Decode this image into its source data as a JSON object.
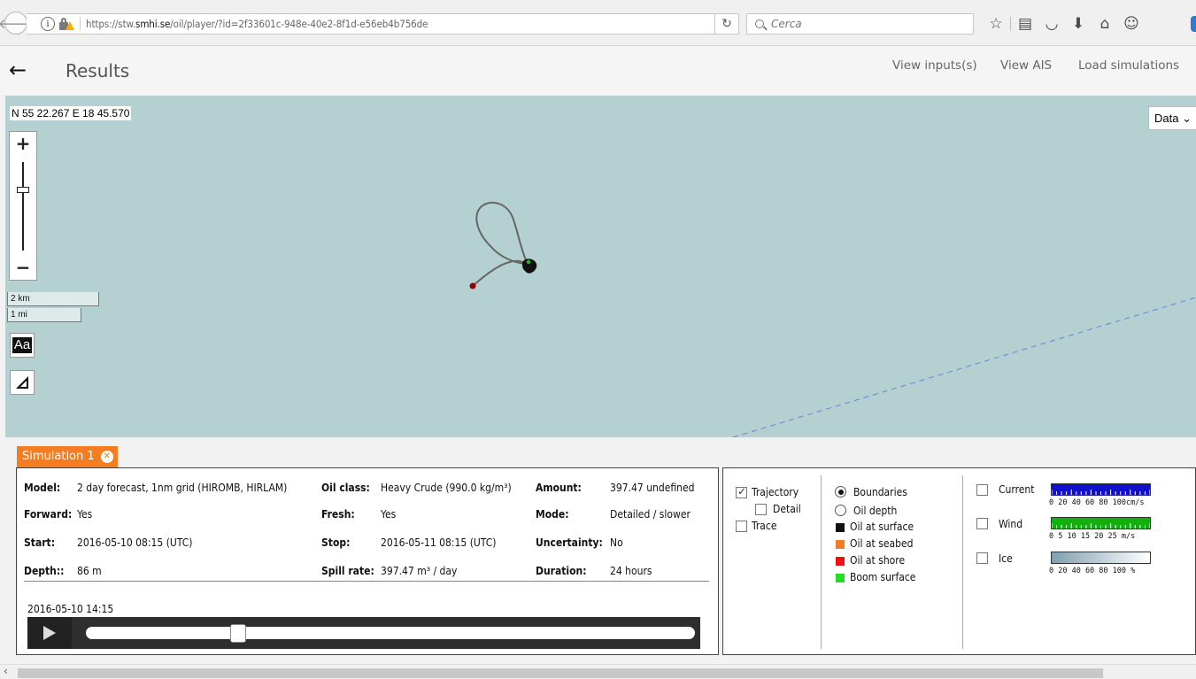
{
  "browser": {
    "url_prefix": "https://stw.",
    "url_domain": "smhi.se",
    "url_rest": "/oil/player/?id=2f33601c-948e-40e2-8f1d-e56eb4b756de",
    "search_placeholder": "Cerca",
    "icons": [
      "star-icon",
      "reader-icon",
      "pocket-icon",
      "download-icon",
      "home-icon",
      "hello-icon"
    ]
  },
  "app": {
    "title": "Results",
    "nav": [
      "View inputs(s)",
      "View AIS",
      "Load simulations"
    ]
  },
  "map": {
    "coordinate": "N 55 22.267 E 18 45.570",
    "layer_select": "Data",
    "zoom_in": "+",
    "zoom_out": "−",
    "scale_km": "2 km",
    "scale_mi": "1 mi",
    "aa_label": "Aa",
    "colors": {
      "sea": "#b5d0d0",
      "track": "#666666",
      "start": "#8b0000",
      "slick": "#111111",
      "boundary": "#6a80e0"
    }
  },
  "simulation": {
    "tab_label": "Simulation 1",
    "info": {
      "model_label": "Model:",
      "model": "2 day forecast, 1nm grid (HIROMB, HIRLAM)",
      "oil_class_label": "Oil class:",
      "oil_class": "Heavy Crude (990.0 kg/m³)",
      "amount_label": "Amount:",
      "amount": "397.47 undefined",
      "forward_label": "Forward:",
      "forward": "Yes",
      "fresh_label": "Fresh:",
      "fresh": "Yes",
      "mode_label": "Mode:",
      "mode": "Detailed / slower",
      "start_label": "Start:",
      "start": "2016-05-10 08:15 (UTC)",
      "stop_label": "Stop:",
      "stop": "2016-05-11 08:15 (UTC)",
      "uncertainty_label": "Uncertainty:",
      "uncertainty": "No",
      "depth_label": "Depth::",
      "depth": "86 m",
      "spill_rate_label": "Spill rate:",
      "spill_rate": "397.47 m³ / day",
      "duration_label": "Duration:",
      "duration": "24 hours"
    },
    "current_time": "2016-05-10 14:15",
    "progress_fraction": 0.25
  },
  "legend": {
    "trajectory": "Trajectory",
    "detail": "Detail",
    "trace": "Trace",
    "boundaries": "Boundaries",
    "oil_depth": "Oil depth",
    "items": [
      {
        "label": "Oil at surface",
        "color": "#111111"
      },
      {
        "label": "Oil at seabed",
        "color": "#f07c28"
      },
      {
        "label": "Oil at shore",
        "color": "#ee1111"
      },
      {
        "label": "Boom surface",
        "color": "#22dd22"
      }
    ],
    "current": "Current",
    "current_ticks": "0  20  40  60  80  100cm/s",
    "wind": "Wind",
    "wind_ticks": "0   5   10  15  20  25  m/s",
    "ice": "Ice",
    "ice_ticks": "0  20  40  60  80  100 %",
    "current_color": "#1010c8",
    "wind_color": "#10b010"
  }
}
